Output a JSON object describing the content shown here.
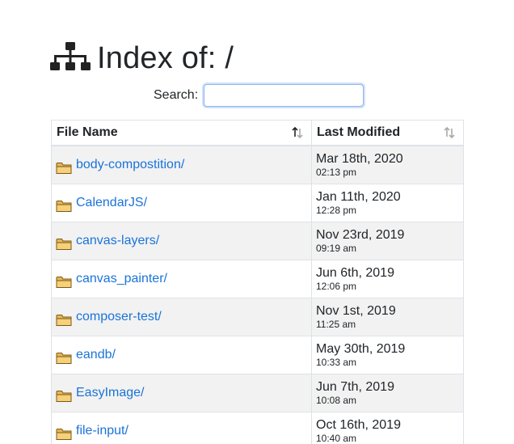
{
  "header": {
    "title": "Index of: /",
    "icon": "sitemap-icon"
  },
  "search": {
    "label": "Search:",
    "value": "",
    "placeholder": ""
  },
  "table": {
    "columns": [
      {
        "label": "File Name",
        "sort_icon": "sort-up-down-active-icon"
      },
      {
        "label": "Last Modified",
        "sort_icon": "sort-up-down-icon"
      }
    ],
    "rows": [
      {
        "name": "body-compostition/",
        "date": "Mar 18th, 2020",
        "time": "02:13 pm"
      },
      {
        "name": "CalendarJS/",
        "date": "Jan 11th, 2020",
        "time": "12:28 pm"
      },
      {
        "name": "canvas-layers/",
        "date": "Nov 23rd, 2019",
        "time": "09:19 am"
      },
      {
        "name": "canvas_painter/",
        "date": "Jun 6th, 2019",
        "time": "12:06 pm"
      },
      {
        "name": "composer-test/",
        "date": "Nov 1st, 2019",
        "time": "11:25 am"
      },
      {
        "name": "eandb/",
        "date": "May 30th, 2019",
        "time": "10:33 am"
      },
      {
        "name": "EasyImage/",
        "date": "Jun 7th, 2019",
        "time": "10:08 am"
      },
      {
        "name": "file-input/",
        "date": "Oct 16th, 2019",
        "time": "10:40 am"
      }
    ]
  },
  "colors": {
    "link": "#1a73d9",
    "stripe": "#f2f2f2",
    "folder_fill": "#f2c76b",
    "folder_stroke": "#8a6a1f"
  }
}
